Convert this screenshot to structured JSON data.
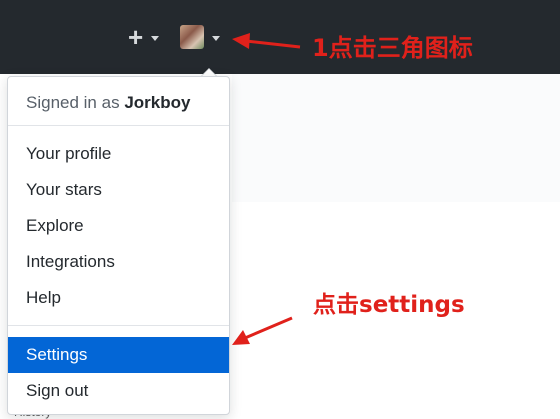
{
  "header": {
    "new_icon": "plus-icon",
    "avatar_icon": "user-avatar"
  },
  "dropdown": {
    "signed_in_prefix": "Signed in as",
    "username": "Jorkboy",
    "items": [
      {
        "label": "Your profile"
      },
      {
        "label": "Your stars"
      },
      {
        "label": "Explore"
      },
      {
        "label": "Integrations"
      },
      {
        "label": "Help"
      }
    ],
    "settings_label": "Settings",
    "signout_label": "Sign out"
  },
  "annotations": {
    "step1": "1点击三角图标",
    "step2": "点击settings",
    "color": "#e0211b"
  },
  "background": {
    "bottom_text": "History"
  },
  "colors": {
    "header_bg": "#24292e",
    "selected_bg": "#0366d6"
  }
}
